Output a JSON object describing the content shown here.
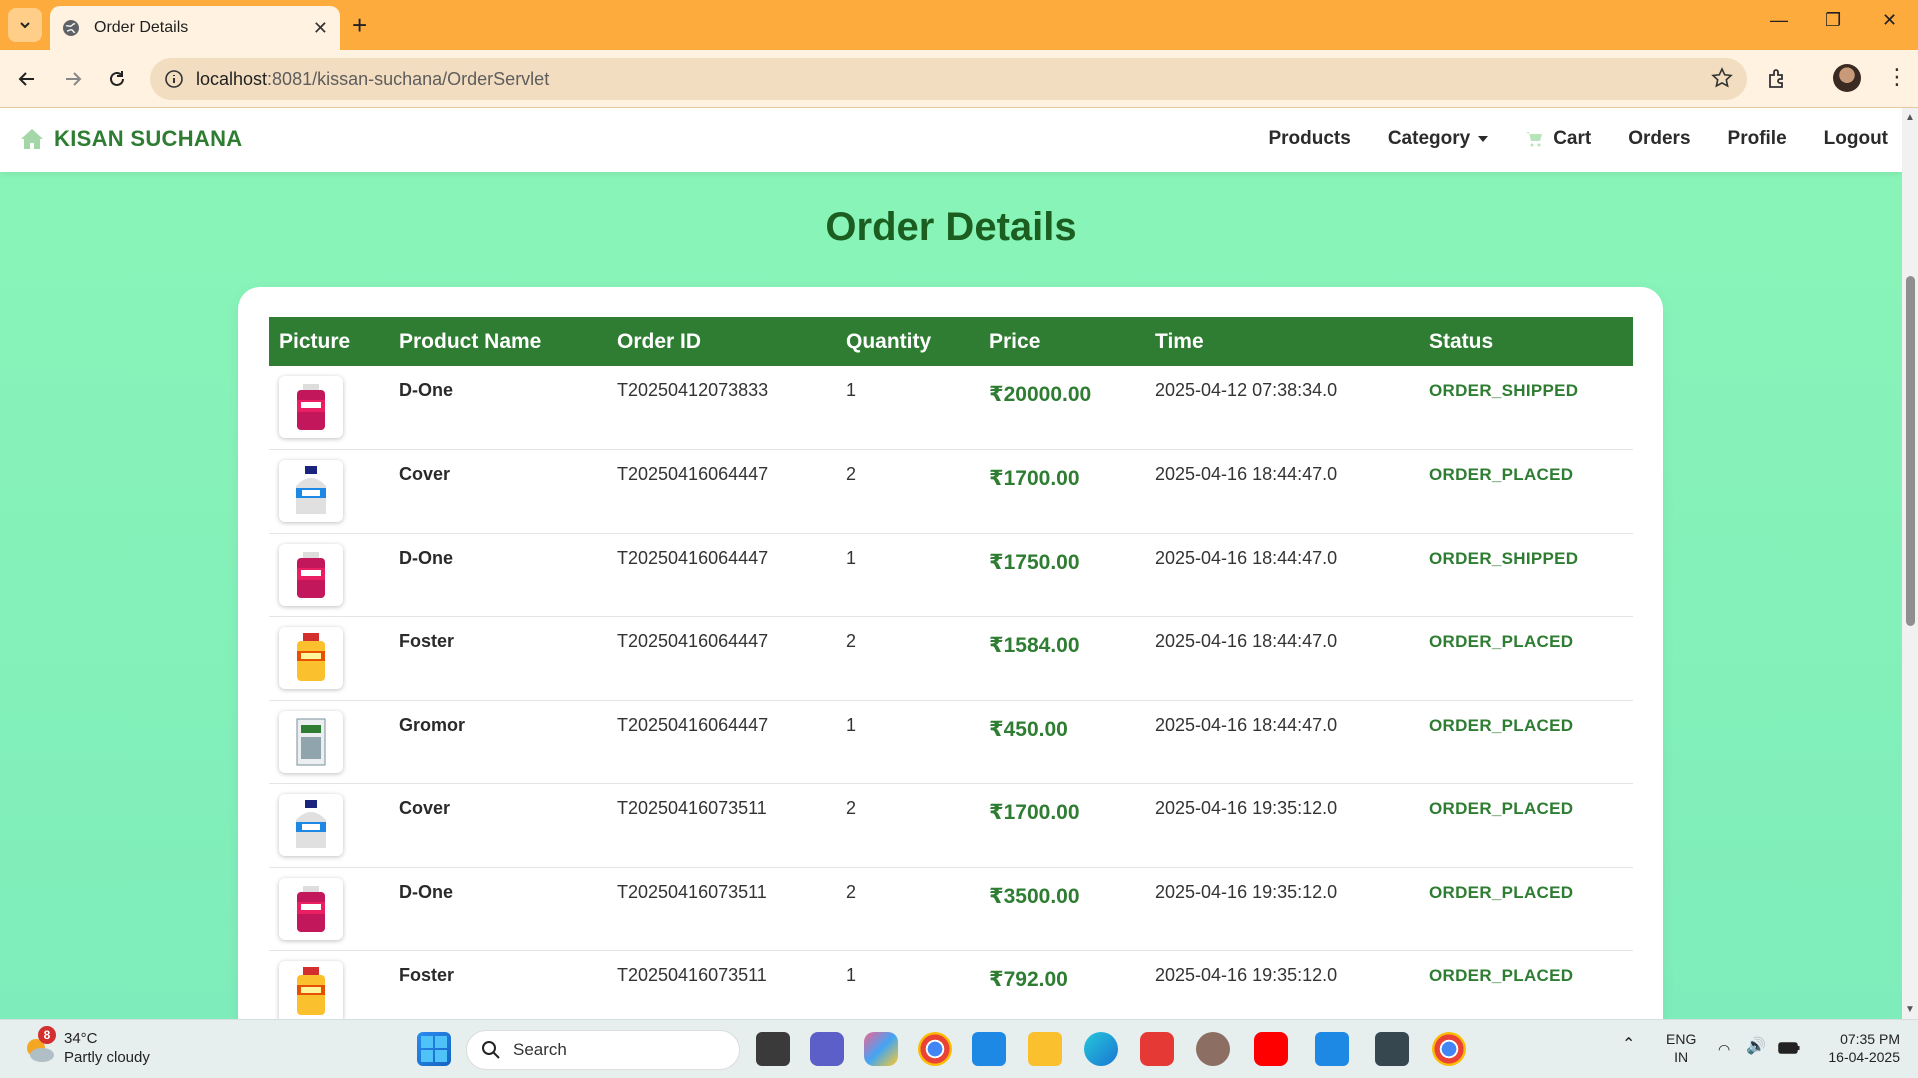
{
  "browser": {
    "tab_title": "Order Details",
    "url_host": "localhost",
    "url_path": ":8081/kissan-suchana/OrderServlet"
  },
  "site": {
    "brand": "KISAN SUCHANA",
    "nav": {
      "products": "Products",
      "category": "Category",
      "cart": "Cart",
      "orders": "Orders",
      "profile": "Profile",
      "logout": "Logout"
    }
  },
  "page": {
    "title": "Order Details"
  },
  "table": {
    "headers": {
      "picture": "Picture",
      "product_name": "Product Name",
      "order_id": "Order ID",
      "quantity": "Quantity",
      "price": "Price",
      "time": "Time",
      "status": "Status"
    },
    "rows": [
      {
        "product": "D-One",
        "product_image": "d-one-product-image",
        "order_id": "T20250412073833",
        "quantity": "1",
        "price": "₹20000.00",
        "time": "2025-04-12 07:38:34.0",
        "status": "ORDER_SHIPPED"
      },
      {
        "product": "Cover",
        "product_image": "cover-product-image",
        "order_id": "T20250416064447",
        "quantity": "2",
        "price": "₹1700.00",
        "time": "2025-04-16 18:44:47.0",
        "status": "ORDER_PLACED"
      },
      {
        "product": "D-One",
        "product_image": "d-one-product-image",
        "order_id": "T20250416064447",
        "quantity": "1",
        "price": "₹1750.00",
        "time": "2025-04-16 18:44:47.0",
        "status": "ORDER_SHIPPED"
      },
      {
        "product": "Foster",
        "product_image": "foster-product-image",
        "order_id": "T20250416064447",
        "quantity": "2",
        "price": "₹1584.00",
        "time": "2025-04-16 18:44:47.0",
        "status": "ORDER_PLACED"
      },
      {
        "product": "Gromor",
        "product_image": "gromor-product-image",
        "order_id": "T20250416064447",
        "quantity": "1",
        "price": "₹450.00",
        "time": "2025-04-16 18:44:47.0",
        "status": "ORDER_PLACED"
      },
      {
        "product": "Cover",
        "product_image": "cover-product-image",
        "order_id": "T20250416073511",
        "quantity": "2",
        "price": "₹1700.00",
        "time": "2025-04-16 19:35:12.0",
        "status": "ORDER_PLACED"
      },
      {
        "product": "D-One",
        "product_image": "d-one-product-image",
        "order_id": "T20250416073511",
        "quantity": "2",
        "price": "₹3500.00",
        "time": "2025-04-16 19:35:12.0",
        "status": "ORDER_PLACED"
      },
      {
        "product": "Foster",
        "product_image": "foster-product-image",
        "order_id": "T20250416073511",
        "quantity": "1",
        "price": "₹792.00",
        "time": "2025-04-16 19:35:12.0",
        "status": "ORDER_PLACED"
      }
    ]
  },
  "taskbar": {
    "weather_badge": "8",
    "temperature": "34°C",
    "weather_desc": "Partly cloudy",
    "search_label": "Search",
    "lang_line1": "ENG",
    "lang_line2": "IN",
    "clock_time": "07:35 PM",
    "clock_date": "16-04-2025"
  },
  "colors": {
    "accent_green": "#2e7d32",
    "title_green": "#1b5e20",
    "page_bg": "#8af5b8",
    "browser_frame": "#fdab3d"
  }
}
